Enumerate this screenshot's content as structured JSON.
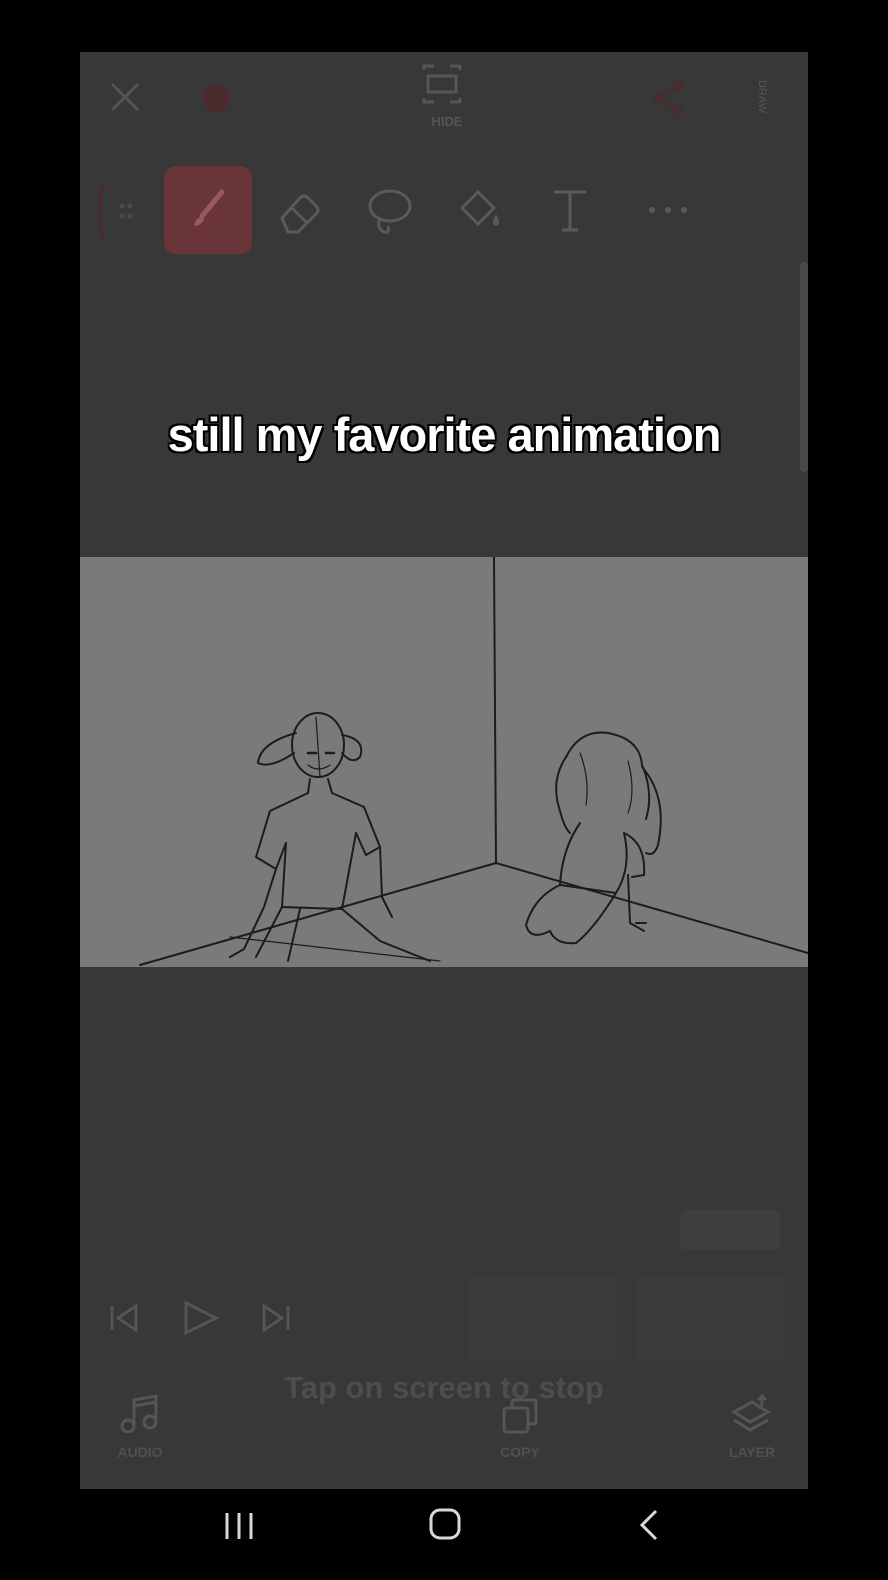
{
  "toolbar_top": {
    "hide_label": "HIDE",
    "side_label": "DRAW"
  },
  "tools": [
    "brush",
    "eraser",
    "lasso",
    "fill",
    "text",
    "more"
  ],
  "caption": {
    "text": "still my favorite animation"
  },
  "playback": {
    "tap_hint": "Tap on screen to stop"
  },
  "bottom_bar": {
    "audio_label": "AUDIO",
    "copy_label": "COPY",
    "layer_label": "LAYER"
  },
  "colors": {
    "accent": "#6a3539",
    "canvas": "#7a7a7a",
    "app_bg": "#383838"
  },
  "icons": [
    "close-icon",
    "record-icon",
    "hide-icon",
    "share-icon",
    "drag-handle-icon",
    "brush-icon",
    "eraser-icon",
    "lasso-icon",
    "fill-icon",
    "text-tool-icon",
    "more-icon",
    "skip-start-icon",
    "play-icon",
    "skip-end-icon",
    "music-note-icon",
    "copy-icon",
    "layer-icon",
    "recents-icon",
    "home-icon",
    "back-icon"
  ]
}
